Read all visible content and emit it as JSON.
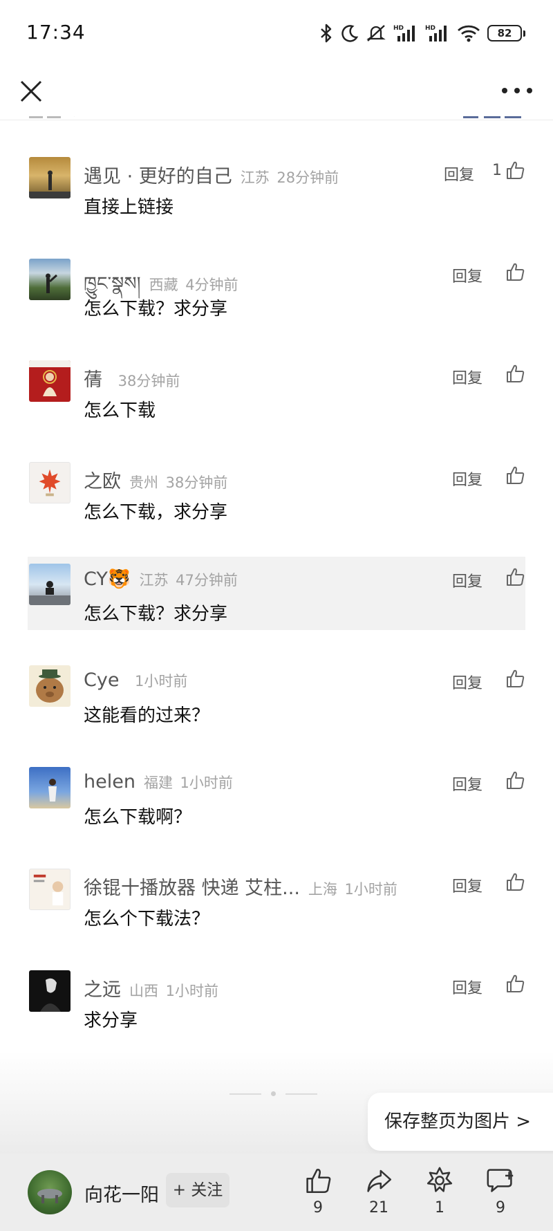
{
  "status_bar": {
    "time": "17:34",
    "battery": "82"
  },
  "comments": [
    {
      "name": "遇见 · 更好的自己",
      "location": "江苏",
      "time": "28分钟前",
      "text": "直接上链接",
      "reply_label": "回复",
      "likes": "1",
      "highlight": false
    },
    {
      "name": "ཁྱུང་སྣས།",
      "location": "西藏",
      "time": "4分钟前",
      "text": "怎么下载？求分享",
      "reply_label": "回复",
      "likes": "",
      "highlight": false
    },
    {
      "name": "蒨",
      "location": "",
      "time": "38分钟前",
      "text": "怎么下载",
      "reply_label": "回复",
      "likes": "",
      "highlight": false
    },
    {
      "name": "之欧",
      "location": "贵州",
      "time": "38分钟前",
      "text": "怎么下载，求分享",
      "reply_label": "回复",
      "likes": "",
      "highlight": false
    },
    {
      "name": "CY🐯",
      "location": "江苏",
      "time": "47分钟前",
      "text": "怎么下载？求分享",
      "reply_label": "回复",
      "likes": "",
      "highlight": true
    },
    {
      "name": "Cye",
      "location": "",
      "time": "1小时前",
      "text": "这能看的过来？",
      "reply_label": "回复",
      "likes": "",
      "highlight": false
    },
    {
      "name": "helen",
      "location": "福建",
      "time": "1小时前",
      "text": "怎么下载啊？",
      "reply_label": "回复",
      "likes": "",
      "highlight": false
    },
    {
      "name": "徐锟十播放器 快递 艾柱...",
      "location": "上海",
      "time": "1小时前",
      "text": "怎么个下载法？",
      "reply_label": "回复",
      "likes": "",
      "highlight": false
    },
    {
      "name": "之远",
      "location": "山西",
      "time": "1小时前",
      "text": "求分享",
      "reply_label": "回复",
      "likes": "",
      "highlight": false
    }
  ],
  "save_page": {
    "label": "保存整页为图片 >"
  },
  "bottom_bar": {
    "author_name": "向花一阳",
    "follow_label": "+ 关注",
    "like_count": "9",
    "share_count": "21",
    "recommend_count": "1",
    "comment_count": "9"
  }
}
